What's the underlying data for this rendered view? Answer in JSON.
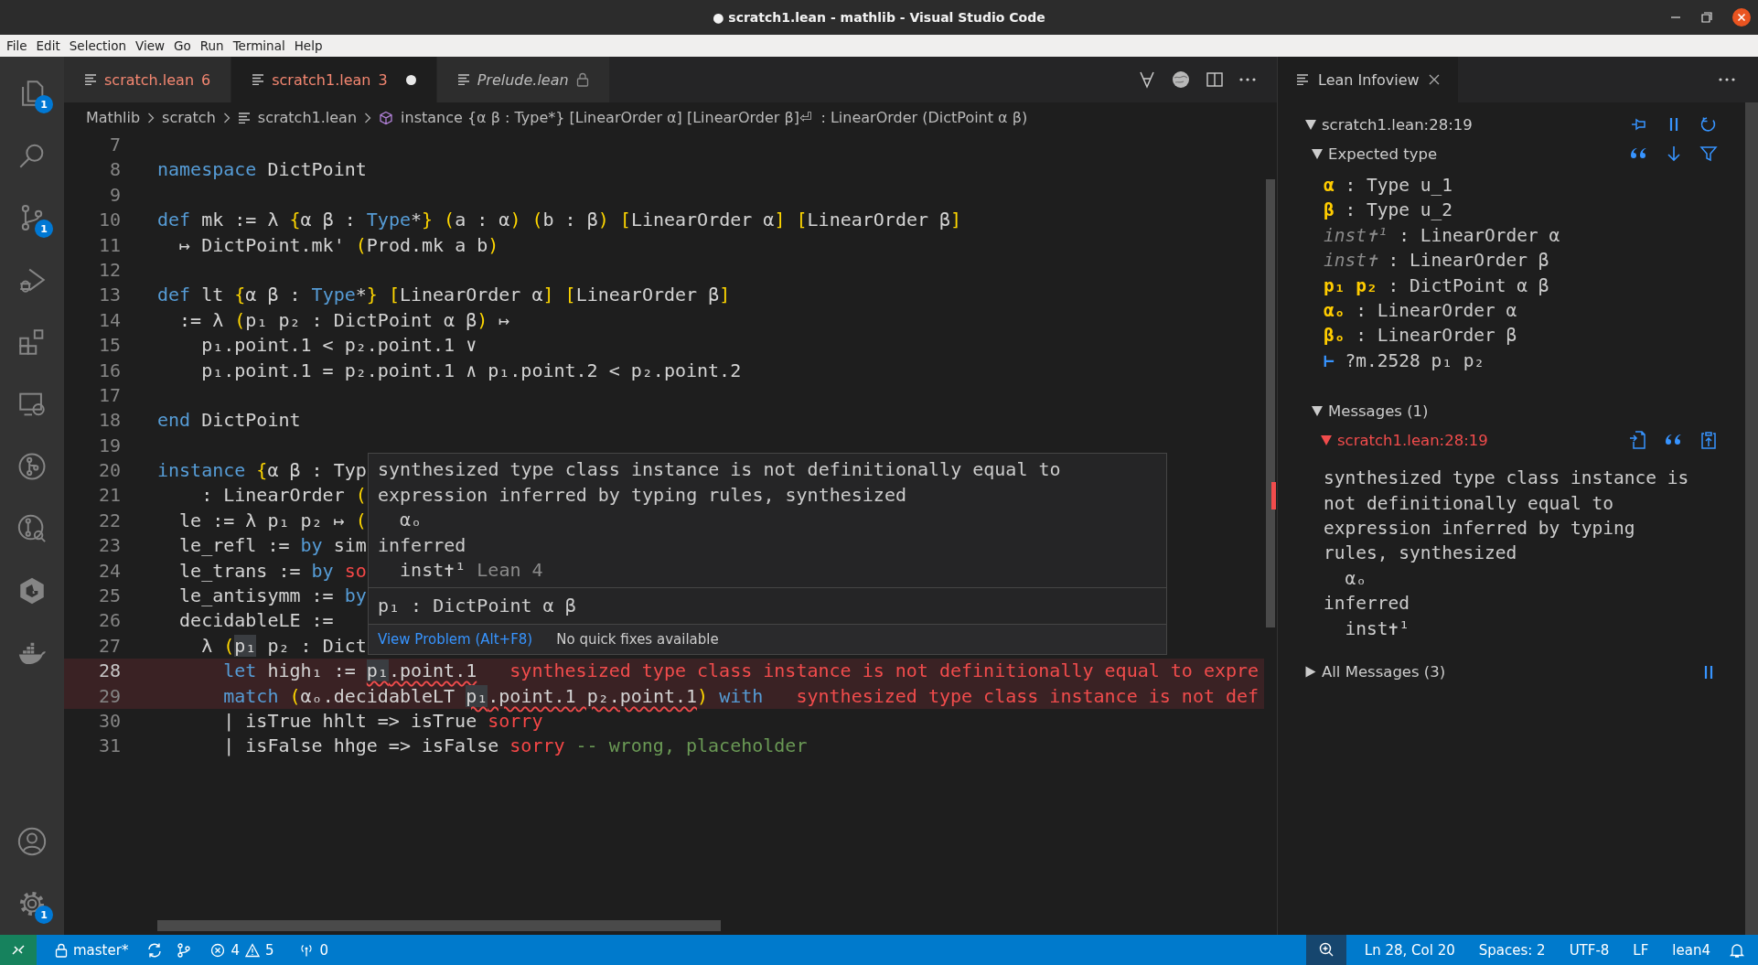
{
  "window": {
    "title": "● scratch1.lean - mathlib - Visual Studio Code"
  },
  "menu": [
    "File",
    "Edit",
    "Selection",
    "View",
    "Go",
    "Run",
    "Terminal",
    "Help"
  ],
  "activity_bar": {
    "top": [
      {
        "kind": "files",
        "badge": "1"
      },
      {
        "kind": "search"
      },
      {
        "kind": "source-control",
        "badge": "1"
      },
      {
        "kind": "run-debug"
      },
      {
        "kind": "extensions"
      },
      {
        "kind": "remote"
      },
      {
        "kind": "git-graph"
      },
      {
        "kind": "git-search"
      },
      {
        "kind": "hex-logo"
      },
      {
        "kind": "whale"
      }
    ],
    "bottom": [
      {
        "kind": "account"
      },
      {
        "kind": "settings",
        "badge": "1"
      }
    ]
  },
  "tabs": [
    {
      "label": "scratch.lean",
      "badge": "6",
      "errors": true,
      "selected": false,
      "modified": false,
      "preview": false,
      "locked": false
    },
    {
      "label": "scratch1.lean",
      "badge": "3",
      "errors": true,
      "selected": true,
      "modified": true,
      "preview": false,
      "locked": false
    },
    {
      "label": "Prelude.lean",
      "errors": false,
      "selected": false,
      "modified": false,
      "preview": true,
      "locked": true
    }
  ],
  "breadcrumb": [
    {
      "kind": "folder",
      "text": "Mathlib"
    },
    {
      "kind": "folder",
      "text": "scratch"
    },
    {
      "kind": "file",
      "text": "scratch1.lean"
    },
    {
      "kind": "symbol",
      "text": "instance {α β : Type*} [LinearOrder α] [LinearOrder β]⏎  : LinearOrder (DictPoint α β)"
    }
  ],
  "editor": {
    "lines": [
      {
        "n": "7"
      },
      {
        "n": "8",
        "tokens": [
          {
            "t": "namespace",
            "kind": "kw"
          },
          {
            "t": " DictPoint"
          }
        ]
      },
      {
        "n": "9"
      },
      {
        "n": "10",
        "tokens": [
          {
            "t": "def",
            "kind": "kw"
          },
          {
            "t": " mk := λ "
          },
          {
            "t": "{",
            "kind": "br"
          },
          {
            "t": "α β : "
          },
          {
            "t": "Type",
            "kind": "ty"
          },
          {
            "t": "*"
          },
          {
            "t": "}",
            "kind": "br"
          },
          {
            "t": " (",
            "kind": "br"
          },
          {
            "t": "a : α"
          },
          {
            "t": ")",
            "kind": "br"
          },
          {
            "t": " (",
            "kind": "br"
          },
          {
            "t": "b : β"
          },
          {
            "t": ")",
            "kind": "br"
          },
          {
            "t": " [",
            "kind": "br"
          },
          {
            "t": "LinearOrder α"
          },
          {
            "t": "]",
            "kind": "br"
          },
          {
            "t": " [",
            "kind": "br"
          },
          {
            "t": "LinearOrder β"
          },
          {
            "t": "]",
            "kind": "br"
          }
        ]
      },
      {
        "n": "11",
        "tokens": [
          {
            "t": "  ↦ DictPoint.mk' "
          },
          {
            "t": "(",
            "kind": "br"
          },
          {
            "t": "Prod.mk a b"
          },
          {
            "t": ")",
            "kind": "br"
          }
        ]
      },
      {
        "n": "12"
      },
      {
        "n": "13",
        "tokens": [
          {
            "t": "def",
            "kind": "kw"
          },
          {
            "t": " lt "
          },
          {
            "t": "{",
            "kind": "br"
          },
          {
            "t": "α β : "
          },
          {
            "t": "Type",
            "kind": "ty"
          },
          {
            "t": "*"
          },
          {
            "t": "}",
            "kind": "br"
          },
          {
            "t": " [",
            "kind": "br"
          },
          {
            "t": "LinearOrder α"
          },
          {
            "t": "]",
            "kind": "br"
          },
          {
            "t": " [",
            "kind": "br"
          },
          {
            "t": "LinearOrder β"
          },
          {
            "t": "]",
            "kind": "br"
          }
        ]
      },
      {
        "n": "14",
        "tokens": [
          {
            "t": "  := λ "
          },
          {
            "t": "(",
            "kind": "br"
          },
          {
            "t": "p₁ p₂ : DictPoint α β"
          },
          {
            "t": ")",
            "kind": "br"
          },
          {
            "t": " ↦"
          }
        ]
      },
      {
        "n": "15",
        "tokens": [
          {
            "t": "    p₁.point.1 < p₂.point.1 ∨"
          }
        ]
      },
      {
        "n": "16",
        "tokens": [
          {
            "t": "    p₁.point.1 = p₂.point.1 ∧ p₁.point.2 < p₂.point.2"
          }
        ]
      },
      {
        "n": "17"
      },
      {
        "n": "18",
        "tokens": [
          {
            "t": "end",
            "kind": "kw"
          },
          {
            "t": " DictPoint"
          }
        ]
      },
      {
        "n": "19"
      },
      {
        "n": "20",
        "tokens": [
          {
            "t": "instance",
            "kind": "kw"
          },
          {
            "t": " {",
            "kind": "br"
          },
          {
            "t": "α β : Typ"
          }
        ]
      },
      {
        "n": "21",
        "tokens": [
          {
            "t": "    : LinearOrder "
          },
          {
            "t": "(",
            "kind": "br"
          }
        ]
      },
      {
        "n": "22",
        "tokens": [
          {
            "t": "  le := λ p₁ p₂ ↦ "
          },
          {
            "t": "(",
            "kind": "br"
          }
        ]
      },
      {
        "n": "23",
        "tokens": [
          {
            "t": "  le_refl := "
          },
          {
            "t": "by",
            "kind": "kw"
          },
          {
            "t": " sim"
          }
        ]
      },
      {
        "n": "24",
        "tokens": [
          {
            "t": "  le_trans := "
          },
          {
            "t": "by",
            "kind": "kw"
          },
          {
            "t": " so",
            "kind": "err"
          }
        ]
      },
      {
        "n": "25",
        "tokens": [
          {
            "t": "  le_antisymm := "
          },
          {
            "t": "by",
            "kind": "kw"
          }
        ]
      },
      {
        "n": "26",
        "tokens": [
          {
            "t": "  decidableLE :="
          }
        ]
      },
      {
        "n": "27",
        "tokens": [
          {
            "t": "    λ "
          },
          {
            "t": "(",
            "kind": "br"
          },
          {
            "t": "p₁",
            "kind": "hl"
          },
          {
            "t": " p₂ : Dict"
          }
        ]
      },
      {
        "n": "28",
        "current": true,
        "error": true,
        "tokens": [
          {
            "t": "      let",
            "kind": "kw"
          },
          {
            "t": " high₁ := "
          },
          {
            "t": "p₁",
            "kind": "hlsq"
          },
          {
            "t": ".point.1",
            "kind": "sq"
          }
        ],
        "inline_error": "synthesized type class instance is not definitionally equal to expre"
      },
      {
        "n": "29",
        "error": true,
        "tokens": [
          {
            "t": "      match",
            "kind": "kw"
          },
          {
            "t": " (",
            "kind": "br"
          },
          {
            "t": "αₒ.decidableLT "
          },
          {
            "t": "p₁",
            "kind": "hlsq"
          },
          {
            "t": ".point.1",
            "kind": "sq"
          },
          {
            "t": " p₂.point.1",
            "kind": "sq"
          },
          {
            "t": ")",
            "kind": "br"
          },
          {
            "t": " with",
            "kind": "kw"
          }
        ],
        "inline_error": "synthesized type class instance is not def"
      },
      {
        "n": "30",
        "tokens": [
          {
            "t": "      | isTrue hhlt => isTrue "
          },
          {
            "t": "sorry",
            "kind": "err"
          }
        ]
      },
      {
        "n": "31",
        "tokens": [
          {
            "t": "      | isFalse hhge => isFalse "
          },
          {
            "t": "sorry",
            "kind": "err"
          },
          {
            "t": " -- wrong, placeholder",
            "kind": "cmt"
          }
        ]
      }
    ]
  },
  "hover": {
    "message": [
      "synthesized type class instance is not definitionally equal to",
      "expression inferred by typing rules, synthesized",
      "  αₒ",
      "inferred",
      "  inst✝¹"
    ],
    "source": "Lean 4",
    "signature": "p₁ : DictPoint α β",
    "action": "View Problem (Alt+F8)",
    "note": "No quick fixes available"
  },
  "infoview": {
    "tab": "Lean Infoview",
    "location": {
      "text": "scratch1.lean:28:19",
      "expanded": true
    },
    "expected": {
      "label": "Expected type",
      "expanded": true,
      "hypotheses": [
        {
          "names": "α",
          "type": ": Type u_1",
          "kind": "named"
        },
        {
          "names": "β",
          "type": ": Type u_2",
          "kind": "named"
        },
        {
          "names": "inst✝¹",
          "type": ": LinearOrder α",
          "kind": "inaccessible"
        },
        {
          "names": "inst✝",
          "type": ": LinearOrder β",
          "kind": "inaccessible"
        },
        {
          "names": "p₁ p₂",
          "type": ": DictPoint α β",
          "kind": "named"
        },
        {
          "names": "αₒ",
          "type": ": LinearOrder α",
          "kind": "named"
        },
        {
          "names": "βₒ",
          "type": ": LinearOrder β",
          "kind": "named"
        }
      ],
      "turnstile": "⊢",
      "goal": "?m.2528 p₁ p₂"
    },
    "messages": {
      "label": "Messages (1)",
      "expanded": true,
      "items": [
        {
          "location": "scratch1.lean:28:19",
          "kind": "error",
          "expanded": true,
          "text": [
            "synthesized type class instance is",
            "not definitionally equal to",
            "expression inferred by typing",
            "rules, synthesized",
            "  αₒ",
            "inferred",
            "  inst✝¹"
          ]
        }
      ]
    },
    "all_messages": {
      "label": "All Messages (3)",
      "expanded": false
    }
  },
  "status_bar": {
    "branch": "master*",
    "errors": "4",
    "warnings": "5",
    "ports": "0",
    "position": "Ln 28, Col 20",
    "indent": "Spaces: 2",
    "encoding": "UTF-8",
    "eol": "LF",
    "language": "lean4"
  }
}
